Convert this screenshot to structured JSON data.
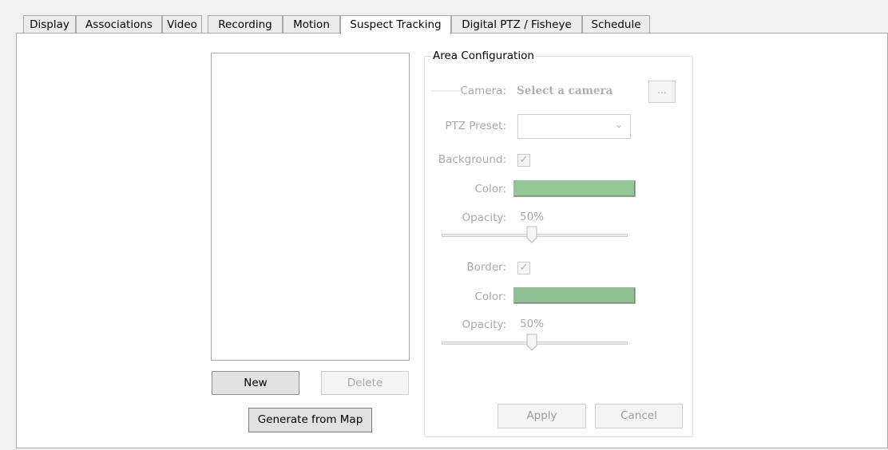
{
  "tabs": [
    "Display",
    "Associations",
    "Video",
    "Recording",
    "Motion",
    "Suspect Tracking",
    "Digital PTZ / Fisheye",
    "Schedule"
  ],
  "active_tab": "Suspect Tracking",
  "buttons": {
    "new": "New",
    "delete": "Delete",
    "generate": "Generate from Map",
    "apply": "Apply",
    "cancel": "Cancel",
    "browse": "..."
  },
  "area_config": {
    "title": "Area Configuration",
    "camera_label": "Camera:",
    "camera_value": "Select a camera",
    "ptz_label": "PTZ Preset:",
    "ptz_value": "",
    "background_label": "Background:",
    "background_checked": true,
    "bg_color_label": "Color:",
    "bg_color": "#93c896",
    "bg_opacity_label": "Opacity:",
    "bg_opacity_value": "50%",
    "bg_opacity_fraction": 0.5,
    "border_label": "Border:",
    "border_checked": true,
    "border_color_label": "Color:",
    "border_color": "#8fbf92",
    "border_opacity_label": "Opacity:",
    "border_opacity_value": "50%",
    "border_opacity_fraction": 0.5
  },
  "colors": {
    "disabled_text": "#a8a8a8",
    "panel_bg": "#ffffff",
    "window_bg": "#f0f0f0"
  }
}
